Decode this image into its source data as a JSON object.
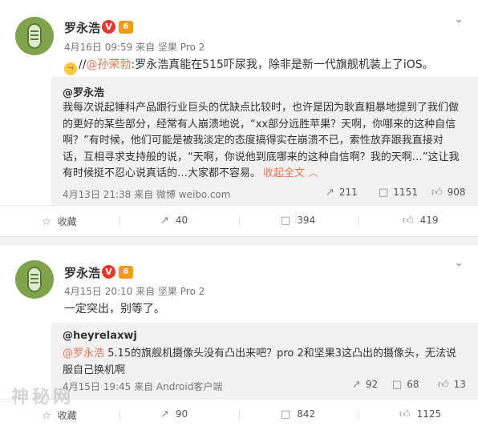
{
  "post1": {
    "author": "罗永浩",
    "v_badge": "V",
    "level_badge": "6",
    "meta": "4月16日 09:59 来自 坚果 Pro 2",
    "text_prefix": "//",
    "mention": "@孙荣勃",
    "text_body": ":罗永浩真能在515吓尿我，除非是新一代旗舰机装上了iOS。",
    "quote": {
      "author": "@罗永浩",
      "text": "我每次说起锤科产品跟行业巨头的优缺点比较时，也许是因为耿直粗暴地提到了我们做的更好的某些部分，经常有人崩溃地说，“xx部分远胜苹果？天啊，你哪来的这种自信啊？”有时候，他们可能是被我淡定的态度搞得实在崩溃不已，索性放弃跟我直接对话，互相寻求支持般的说，“天啊，你说他到底哪来的这种自信啊？我的天啊…”这让我有时候挺不忍心说真话的…大家都不容易。",
      "expand": "收起全文 ︿",
      "meta": "4月13日 21:38 来自 微博 weibo.com",
      "repost_count": "211",
      "comment_count": "1151",
      "like_count": "908"
    },
    "actions": {
      "favorite": "收藏",
      "repost": "40",
      "comment": "394",
      "like": "419"
    }
  },
  "post2": {
    "author": "罗永浩",
    "v_badge": "V",
    "level_badge": "6",
    "meta": "4月15日 20:10 来自 坚果 Pro 2",
    "text": "一定突出，别等了。",
    "quote": {
      "author": "@heyrelaxwj",
      "mention": "@罗永浩",
      "text": " 5.15的旗舰机摄像头没有凸出来吧？pro 2和坚果3这凸出的摄像头，无法说服自己换机啊",
      "meta": "4月15日 19:45 来自 Android客户端",
      "repost_count": "92",
      "comment_count": "68",
      "like_count": "13"
    },
    "actions": {
      "favorite": "收藏",
      "repost": "90",
      "comment": "842",
      "like": "1125"
    }
  },
  "watermark": "神秘网",
  "icons": {
    "chevron": "chevron-down-icon",
    "favorite": "star-icon",
    "repost": "repost-icon",
    "comment": "comment-icon",
    "like": "thumbs-up-icon"
  },
  "colors": {
    "mention": "#eb7350",
    "v_badge": "#e8372c",
    "level_badge": "#f39a1d",
    "avatar": "#7fa34a"
  }
}
